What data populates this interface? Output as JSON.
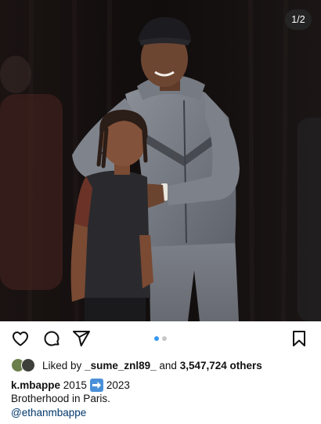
{
  "photo": {
    "counter": "1/2",
    "description_name": "post-photo"
  },
  "actions": {
    "icons": [
      "heart-icon",
      "comment-icon",
      "share-icon",
      "bookmark-icon"
    ],
    "carousel": {
      "total": 2,
      "active": 1
    }
  },
  "likes": {
    "prefix": "Liked by",
    "user": "_sume_znl89_",
    "and": "and",
    "count": "3,547,724 others"
  },
  "caption": {
    "username": "k.mbappe",
    "year_from": "2015",
    "arrow": "➡️",
    "year_to": "2023",
    "line2": "Brotherhood in Paris.",
    "mention": "@ethanmbappe"
  },
  "colors": {
    "accent_dot": "#3897f0",
    "mention": "#00376b",
    "arrow_emoji_bg": "#4a90d9"
  }
}
